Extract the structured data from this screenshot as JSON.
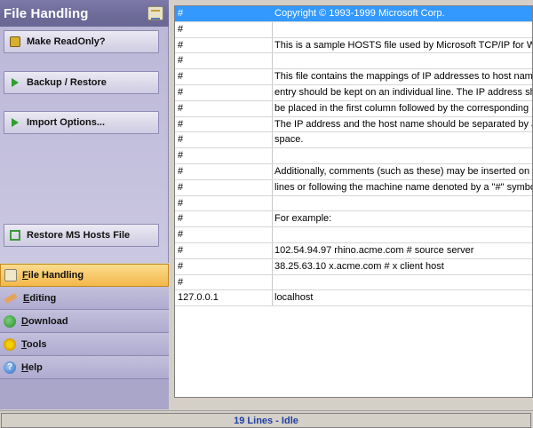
{
  "panel": {
    "title": "File Handling",
    "buttons": [
      {
        "label": "Make ReadOnly?"
      },
      {
        "label": "Backup / Restore"
      },
      {
        "label": "Import Options..."
      },
      {
        "label": "Restore MS Hosts File"
      }
    ]
  },
  "nav": {
    "items": [
      {
        "label": "File Handling",
        "first": "F",
        "rest": "ile Handling"
      },
      {
        "label": "Editing",
        "first": "E",
        "rest": "diting"
      },
      {
        "label": "Download",
        "first": "D",
        "rest": "ownload"
      },
      {
        "label": "Tools",
        "first": "T",
        "rest": "ools"
      },
      {
        "label": "Help",
        "first": "H",
        "rest": "elp"
      }
    ]
  },
  "grid": {
    "rows": [
      {
        "c1": "#",
        "c2": "Copyright © 1993-1999 Microsoft Corp."
      },
      {
        "c1": "#",
        "c2": ""
      },
      {
        "c1": "#",
        "c2": "This is a sample HOSTS file used by Microsoft TCP/IP for Windows."
      },
      {
        "c1": "#",
        "c2": ""
      },
      {
        "c1": "#",
        "c2": "This file contains the mappings of IP addresses to host names. Each"
      },
      {
        "c1": "#",
        "c2": "entry should be kept on an individual line. The IP address should"
      },
      {
        "c1": "#",
        "c2": "be placed in the first column followed by the corresponding host name."
      },
      {
        "c1": "#",
        "c2": "The IP address and the host name should be separated by at least one"
      },
      {
        "c1": "#",
        "c2": "space."
      },
      {
        "c1": "#",
        "c2": ""
      },
      {
        "c1": "#",
        "c2": "Additionally, comments (such as these) may be inserted on individual"
      },
      {
        "c1": "#",
        "c2": "lines or following the machine name denoted by a \"#\" symbol."
      },
      {
        "c1": "#",
        "c2": ""
      },
      {
        "c1": "#",
        "c2": "For example:"
      },
      {
        "c1": "#",
        "c2": ""
      },
      {
        "c1": "#",
        "c2": "102.54.94.97 rhino.acme.com # source server"
      },
      {
        "c1": "#",
        "c2": "38.25.63.10 x.acme.com # x client host"
      },
      {
        "c1": "#",
        "c2": ""
      },
      {
        "c1": "127.0.0.1",
        "c2": "localhost"
      }
    ]
  },
  "status": {
    "text": "19 Lines - Idle"
  },
  "colors": {
    "selection": "#3399ff",
    "status_text": "#1f3fa4",
    "active_nav": "#f3b84a"
  }
}
